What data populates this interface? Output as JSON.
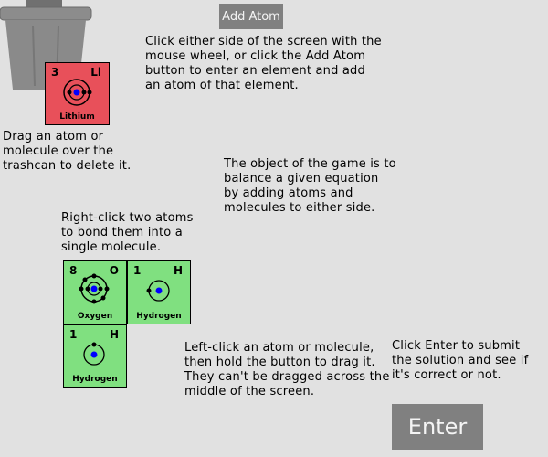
{
  "buttons": {
    "add_atom": "Add Atom",
    "enter": "Enter"
  },
  "instructions": {
    "add": [
      "Click either side of the screen with the",
      "mouse wheel, or click the Add Atom",
      "button to enter an element and add",
      "an atom of that element."
    ],
    "delete": [
      "Drag an atom or",
      "molecule over the",
      "trashcan to delete it."
    ],
    "objective": [
      "The object of the game is to",
      "balance a given equation",
      "by adding atoms and",
      "molecules to either side."
    ],
    "bond": [
      "Right-click two atoms",
      "to bond them into a",
      "single molecule."
    ],
    "drag": [
      "Left-click an atom or molecule,",
      "then hold the button to drag it.",
      "They can't be dragged across the",
      "middle of the screen."
    ],
    "submit": [
      "Click Enter to submit",
      "the solution and see if",
      "it's correct or not."
    ]
  },
  "atoms": {
    "lithium": {
      "number": "3",
      "symbol": "Li",
      "name": "Lithium"
    },
    "oxygen": {
      "number": "8",
      "symbol": "O",
      "name": "Oxygen"
    },
    "hydrogen_1": {
      "number": "1",
      "symbol": "H",
      "name": "Hydrogen"
    },
    "hydrogen_2": {
      "number": "1",
      "symbol": "H",
      "name": "Hydrogen"
    }
  },
  "icons": {
    "trashcan": "trashcan-icon"
  },
  "colors": {
    "background": "#e1e1e1",
    "button": "#808080",
    "tile_red": "#e8505a",
    "tile_green": "#80e080",
    "nucleus": "#0000ff"
  }
}
